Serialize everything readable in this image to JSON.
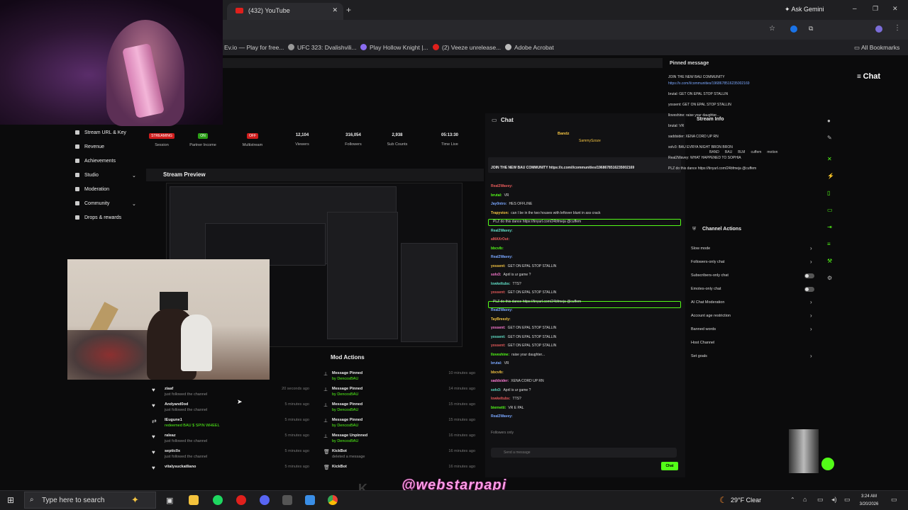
{
  "browser": {
    "tab_title": "(432) YouTube",
    "new_tab": "+",
    "gemini": "Ask Gemini",
    "bookmarks": [
      "Ev.io — Play for free...",
      "UFC 323: Dvalishvili...",
      "Play Hollow Knight |...",
      "(2) Veeze unrelease...",
      "Adobe Acrobat"
    ],
    "all_bookmarks": "All Bookmarks"
  },
  "dashboard": {
    "sidebar": [
      "Stream URL & Key",
      "Revenue",
      "Achievements",
      "Studio",
      "Moderation",
      "Community",
      "Drops & rewards"
    ],
    "stats": [
      {
        "label": "Session",
        "value": "STREAMING"
      },
      {
        "label": "Partner Income",
        "value": "ON"
      },
      {
        "label": "Multistream",
        "value": "OFF"
      },
      {
        "label": "Viewers",
        "value": "12,104"
      },
      {
        "label": "Followers",
        "value": "316,054"
      },
      {
        "label": "Sub Counts",
        "value": "2,938"
      },
      {
        "label": "Time Live",
        "value": "05:13:30"
      }
    ],
    "stream_preview": "Stream Preview",
    "activity": [
      {
        "name": "ziaaf",
        "sub": "just followed the channel",
        "time": "20 seconds ago"
      },
      {
        "name": "Andyand0od",
        "sub": "just followed the channel",
        "time": "5 minutes ago"
      },
      {
        "name": "lEugune1",
        "sub": "redeemed BAU $ SPIN WHEEL",
        "time": "5 minutes ago"
      },
      {
        "name": "raleaz",
        "sub": "just followed the channel",
        "time": "5 minutes ago"
      },
      {
        "name": "septic0x",
        "sub": "just followed the channel",
        "time": "5 minutes ago"
      },
      {
        "name": "vitalysuckatliano",
        "sub": "",
        "time": "5 minutes ago"
      }
    ],
    "mod_actions": {
      "title": "Mod Actions",
      "rows": [
        {
          "title": "Message Pinned",
          "by": "by DencosBAU",
          "time": "10 minutes ago"
        },
        {
          "title": "Message Pinned",
          "by": "by DencosBAU",
          "time": "14 minutes ago"
        },
        {
          "title": "Message Pinned",
          "by": "by DencosBAU",
          "time": "15 minutes ago"
        },
        {
          "title": "Message Pinned",
          "by": "by DencosBAU",
          "time": "15 minutes ago"
        },
        {
          "title": "Message Unpinned",
          "by": "by DencosBAU",
          "time": "16 minutes ago"
        },
        {
          "title": "KickBot",
          "by": "deleted a message",
          "time": "16 minutes ago"
        },
        {
          "title": "KickBot",
          "by": "",
          "time": "16 minutes ago"
        }
      ]
    }
  },
  "chat": {
    "title": "Chat",
    "top_user": "Bandz",
    "top_sub": "SammySzoze",
    "pinned_line": "JOIN THE NEW BAU COMMUNITY https://x.com/i/communities/1968678516235002169",
    "messages": [
      {
        "user": "Real2Wavey:",
        "text": ""
      },
      {
        "user": "brutal:",
        "text": "VR"
      },
      {
        "user": "Jay0ntro:",
        "text": "HES OFFLINE"
      },
      {
        "user": "Trapyvion:",
        "text": "can I be in the two houses with leftover blunt in ass crack"
      },
      {
        "user": "",
        "text": "PLZ do this dance https://tinyurl.com/24bfmeja @cuffem"
      },
      {
        "user": "Real2Wavey:",
        "text": ""
      },
      {
        "user": "aMAXrOut:",
        "text": ""
      },
      {
        "user": "bbcvib:",
        "text": ""
      },
      {
        "user": "Real2Wavey:",
        "text": ""
      },
      {
        "user": "yossent:",
        "text": "GET ON EPAL STOP STALLIN"
      },
      {
        "user": "solv3:",
        "text": "April is ur game ?"
      },
      {
        "user": "lowkeltubs:",
        "text": "TTS?"
      },
      {
        "user": "yossent:",
        "text": "GET ON EPAL STOP STALLIN"
      },
      {
        "user": "",
        "text": "PLZ do this dance https://tinyurl.com/24bfmeja @cuffem"
      },
      {
        "user": "Real2Wavey:",
        "text": ""
      },
      {
        "user": "TayBreezly:",
        "text": ""
      },
      {
        "user": "yossent:",
        "text": "GET ON EPAL STOP STALLIN"
      },
      {
        "user": "yossent:",
        "text": "GET ON EPAL STOP STALLIN"
      },
      {
        "user": "yossent:",
        "text": "GET ON EPAL STOP STALLIN"
      },
      {
        "user": "lloveshine:",
        "text": "raise your daughter..."
      },
      {
        "user": "brutal:",
        "text": "VR"
      },
      {
        "user": "bbcvib:",
        "text": ""
      },
      {
        "user": "saddsider:",
        "text": "XENA CORD UP RN"
      },
      {
        "user": "solv3:",
        "text": "April is ur game ?"
      },
      {
        "user": "lowkeltubs:",
        "text": "TTS?"
      },
      {
        "user": "biernetti:",
        "text": "VR E PAL"
      },
      {
        "user": "Real2Wavey:",
        "text": ""
      }
    ],
    "followers_only": "Followers only",
    "input_placeholder": "Send a message",
    "send": "Chat"
  },
  "side_panel": {
    "pinned_title": "Pinned message",
    "pinned_lines": [
      "JOIN THE NEW BAU COMMUNITY",
      "https://x.com/i/communities/1968678516235002169",
      "brutal: GET ON EPAL STOP STALLIN",
      "yossent: GET ON EPAL STOP STALLIN",
      "lloveshine: raise your daughter...",
      "brutal: VR",
      "saddsider: XENA CORD UP RN",
      "solv3: BAU EVRYA NIGHT BRON BRON",
      "Real2Wavey: WHAT HAPPENED TO SOPHIA",
      "PLZ do this dance https://tinyurl.com/24bfmeja @cuffem"
    ],
    "stream_info": "Stream Info",
    "tags": [
      "BAND",
      "BAU",
      "BLM",
      "cuffem",
      "motion"
    ],
    "channel_actions": {
      "title": "Channel Actions",
      "rows": [
        {
          "label": "Slow mode",
          "control": "chevron"
        },
        {
          "label": "Followers-only chat",
          "control": "chevron"
        },
        {
          "label": "Subscribers-only chat",
          "control": "toggle"
        },
        {
          "label": "Emotes-only chat",
          "control": "toggle"
        },
        {
          "label": "AI Chat Moderation",
          "control": "chevron"
        },
        {
          "label": "Account age restriction",
          "control": "chevron"
        },
        {
          "label": "Banned words",
          "control": "chevron"
        },
        {
          "label": "Host Channel",
          "control": "none"
        },
        {
          "label": "Set goals",
          "control": "chevron"
        }
      ]
    },
    "chat_button": "Chat"
  },
  "overlay": {
    "watermark": "@webstarpapi"
  },
  "taskbar": {
    "search": "Type here to search",
    "weather": "29°F  Clear",
    "time": "3:24 AM",
    "date": "3/20/2026"
  },
  "colors": {
    "kick_green": "#53fc18",
    "watermark_pink": "#ff9be8"
  }
}
